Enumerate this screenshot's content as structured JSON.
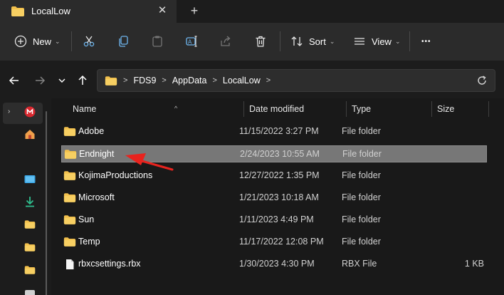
{
  "tab": {
    "title": "LocalLow",
    "close_glyph": "✕",
    "new_tab_glyph": "+"
  },
  "toolbar": {
    "new_label": "New",
    "sort_label": "Sort",
    "view_label": "View",
    "more_glyph": "•••",
    "icons": [
      "plus-circle-icon",
      "cut-icon",
      "copy-icon",
      "paste-icon",
      "rename-icon",
      "share-icon",
      "delete-icon",
      "sort-icon",
      "view-icon",
      "more-icon"
    ]
  },
  "address": {
    "crumbs": [
      "FDS9",
      "AppData",
      "LocalLow"
    ],
    "separator": ">"
  },
  "columns": {
    "name": "Name",
    "date": "Date modified",
    "type": "Type",
    "size": "Size"
  },
  "files": [
    {
      "name": "Adobe",
      "date": "11/15/2022 3:27 PM",
      "type": "File folder",
      "size": "",
      "icon": "folder-icon"
    },
    {
      "name": "Endnight",
      "date": "2/24/2023 10:55 AM",
      "type": "File folder",
      "size": "",
      "icon": "folder-icon",
      "selected": true
    },
    {
      "name": "KojimaProductions",
      "date": "12/27/2022 1:35 PM",
      "type": "File folder",
      "size": "",
      "icon": "folder-icon"
    },
    {
      "name": "Microsoft",
      "date": "1/21/2023 10:18 AM",
      "type": "File folder",
      "size": "",
      "icon": "folder-icon"
    },
    {
      "name": "Sun",
      "date": "1/11/2023 4:49 PM",
      "type": "File folder",
      "size": "",
      "icon": "folder-icon"
    },
    {
      "name": "Temp",
      "date": "11/17/2022 12:08 PM",
      "type": "File folder",
      "size": "",
      "icon": "folder-icon"
    },
    {
      "name": "rbxcsettings.rbx",
      "date": "1/30/2023 4:30 PM",
      "type": "RBX File",
      "size": "1 KB",
      "icon": "file-icon"
    }
  ],
  "colors": {
    "background": "#191919",
    "panel": "#2b2b2b",
    "selection": "#777777",
    "folder": "#f2c04c",
    "annotation_arrow": "#e8231e"
  }
}
